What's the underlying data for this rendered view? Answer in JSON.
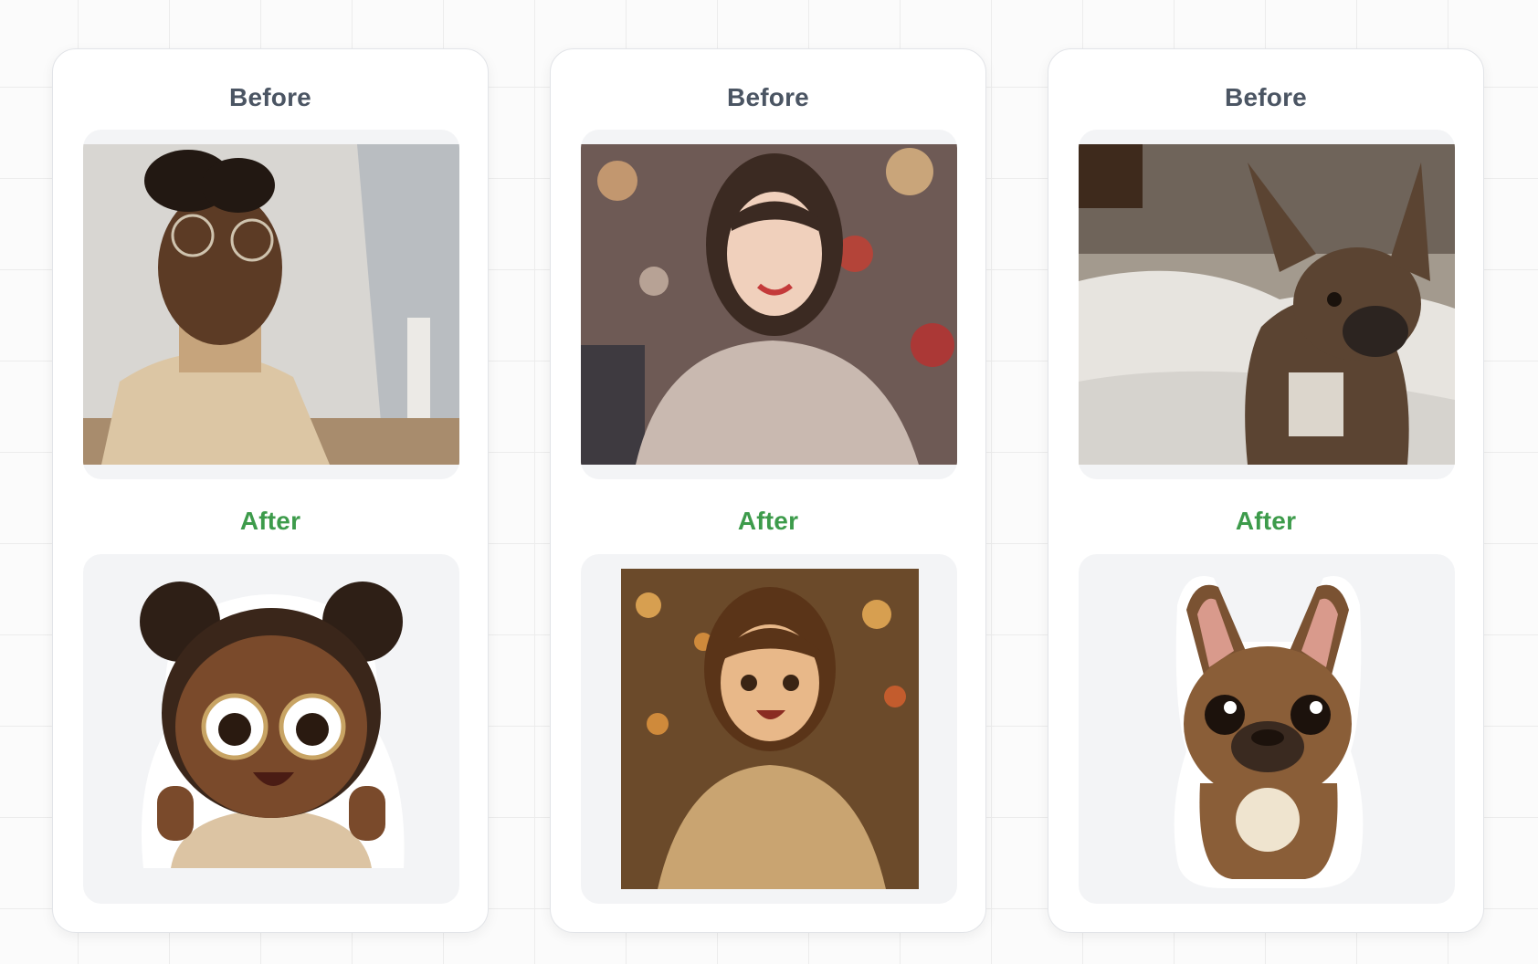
{
  "cards": [
    {
      "before_label": "Before",
      "after_label": "After",
      "before_image": "woman-selfie-photo",
      "after_image": "chibi-sticker-illustration"
    },
    {
      "before_label": "Before",
      "after_label": "After",
      "before_image": "woman-street-photo",
      "after_image": "anime-style-illustration"
    },
    {
      "before_label": "Before",
      "after_label": "After",
      "before_image": "french-bulldog-photo",
      "after_image": "bulldog-sticker-illustration"
    }
  ],
  "colors": {
    "before_label": "#4b5563",
    "after_label": "#3d9b4b",
    "frame_bg": "#f3f4f6"
  }
}
